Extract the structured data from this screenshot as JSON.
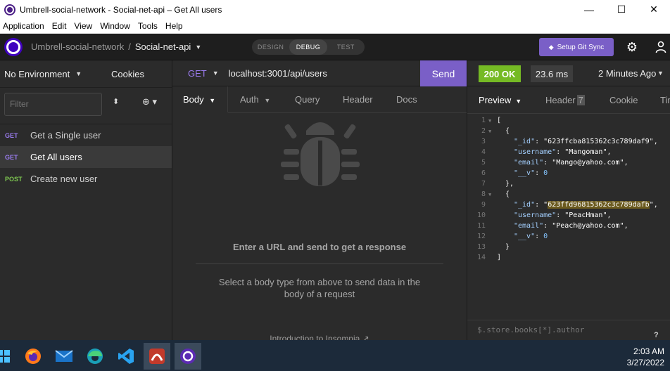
{
  "window": {
    "title": "Umbrell-social-network - Social-net-api – Get All users",
    "min": "—",
    "max": "☐",
    "close": "✕"
  },
  "menu": [
    "Application",
    "Edit",
    "View",
    "Window",
    "Tools",
    "Help"
  ],
  "appbar": {
    "project": "Umbrell-social-network",
    "separator": "/",
    "collection": "Social-net-api",
    "modes": [
      "DESIGN",
      "DEBUG",
      "TEST"
    ],
    "active_mode": "DEBUG",
    "git_sync": "Setup Git Sync"
  },
  "sidebar": {
    "environment": "No Environment",
    "cookies": "Cookies",
    "filter_placeholder": "Filter",
    "requests": [
      {
        "method": "GET",
        "name": "Get a Single user"
      },
      {
        "method": "GET",
        "name": "Get All users"
      },
      {
        "method": "POST",
        "name": "Create new user"
      }
    ]
  },
  "request": {
    "method": "GET",
    "url": "localhost:3001/api/users",
    "send": "Send",
    "tabs": [
      "Body",
      "Auth",
      "Query",
      "Header",
      "Docs"
    ],
    "empty_title": "Enter a URL and send to get a response",
    "empty_body": "Select a body type from above to send data in the body of a request",
    "intro": "Introduction to Insomnia"
  },
  "response": {
    "status": "200 OK",
    "time": "23.6 ms",
    "ago": "2 Minutes Ago",
    "tabs": [
      "Preview",
      "Header",
      "Cookie",
      "Timeline"
    ],
    "header_count": "7",
    "lines": [
      "1",
      "2",
      "3",
      "4",
      "5",
      "6",
      "7",
      "8",
      "9",
      "10",
      "11",
      "12",
      "13",
      "14"
    ],
    "json": {
      "open_bracket": "[",
      "close_bracket": "]",
      "open_brace": "{",
      "close_brace": "}",
      "close_brace_comma": "},",
      "k_id": "\"_id\"",
      "k_username": "\"username\"",
      "k_email": "\"email\"",
      "k_v": "\"__v\"",
      "id1": "\"623ffcba815362c3c789daf9\"",
      "username1": "\"Mangoman\"",
      "email1": "\"Mango@yahoo.com\"",
      "v1": "0",
      "id2_q1": "\"",
      "id2": "623ffd96815362c3c789dafb",
      "id2_q2": "\"",
      "username2": "\"PeacHman\"",
      "email2": "\"Peach@yahoo.com\"",
      "v2": "0"
    },
    "jsonpath_placeholder": "$.store.books[*].author"
  },
  "taskbar": {
    "time": "2:03 AM",
    "date": "3/27/2022"
  }
}
